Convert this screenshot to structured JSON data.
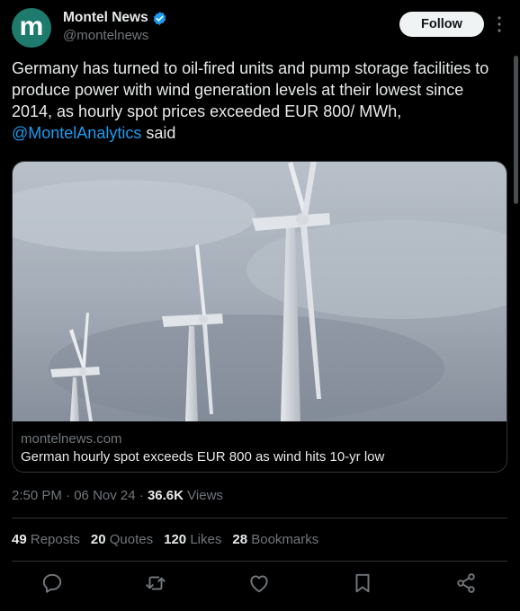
{
  "user": {
    "avatar_letter": "m",
    "name": "Montel News",
    "handle": "@montelnews",
    "verified": true
  },
  "header": {
    "follow_label": "Follow"
  },
  "tweet": {
    "text_before": "Germany has turned to oil-fired units and pump storage facilities to produce power with wind generation levels at their lowest since 2014, as hourly spot prices exceeded EUR 800/ MWh, ",
    "mention": "@MontelAnalytics",
    "text_after": " said"
  },
  "card": {
    "domain": "montelnews.com",
    "title": "German hourly spot exceeds EUR 800 as wind hits 10-yr low"
  },
  "meta": {
    "time": "2:50 PM",
    "date": "06 Nov 24",
    "views_count": "36.6K",
    "views_label": "Views"
  },
  "stats": {
    "reposts_count": "49",
    "reposts_label": "Reposts",
    "quotes_count": "20",
    "quotes_label": "Quotes",
    "likes_count": "120",
    "likes_label": "Likes",
    "bookmarks_count": "28",
    "bookmarks_label": "Bookmarks"
  },
  "actions": [
    "reply-icon",
    "repost-icon",
    "like-icon",
    "bookmark-icon",
    "share-icon"
  ],
  "colors": {
    "accent": "#1d9bf0",
    "background": "#000000",
    "text": "#e7e9ea",
    "muted": "#71767b",
    "avatar": "#1f7a6e"
  }
}
